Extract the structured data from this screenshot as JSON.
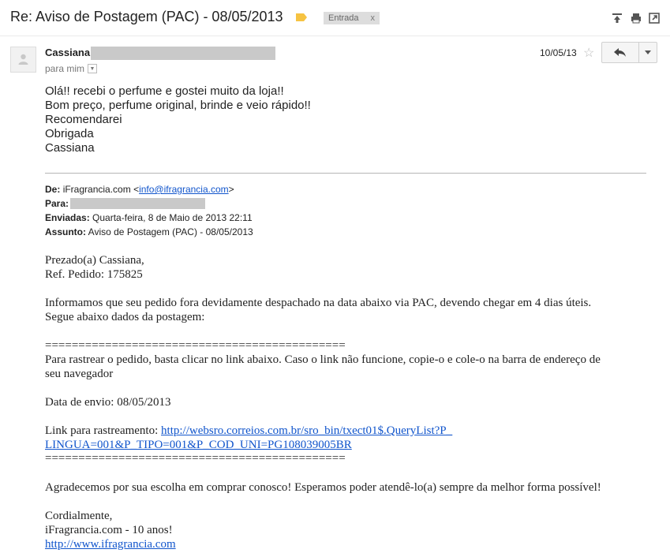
{
  "header": {
    "subject": "Re: Aviso de Postagem (PAC) - 08/05/2013",
    "label_name": "Entrada",
    "label_remove": "x",
    "label_color": "#f6c342",
    "icons": [
      "archive-icon",
      "print-icon",
      "new-window-icon"
    ]
  },
  "message": {
    "sender_name": "Cassiana",
    "to_text": "para mim",
    "date": "10/05/13",
    "body_lines": [
      "Olá!! recebi o perfume e gostei muito da loja!!",
      "Bom preço, perfume original, brinde e veio rápido!!",
      "Recomendarei",
      "Obrigada",
      "Cassiana"
    ]
  },
  "quoted": {
    "from_label": "De:",
    "from_name": "iFragrancia.com",
    "from_open": "<",
    "from_email": "info@ifragrancia.com",
    "from_close": ">",
    "to_label": "Para:",
    "sent_label": "Enviadas:",
    "sent_value": "Quarta-feira, 8 de Maio de 2013 22:11",
    "subject_label": "Assunto:",
    "subject_value": "Aviso de Postagem (PAC) - 08/05/2013",
    "greeting": "Prezado(a) Cassiana,",
    "ref": "Ref. Pedido: 175825",
    "para1_line1": "Informamos que seu pedido fora devidamente despachado na data abaixo via PAC, devendo chegar em 4 dias úteis.",
    "para1_line2": "Segue abaixo dados da postagem:",
    "separator": "=============================================",
    "track_line1": "Para rastrear o pedido, basta clicar no link abaixo. Caso o link não funcione, copie-o e cole-o na barra de endereço de",
    "track_line2": "seu navegador",
    "ship_date": "Data de envio: 08/05/2013",
    "link_label": "Link para rastreamento: ",
    "link_part1": "http://websro.correios.com.br/sro_bin/txect01$.QueryList?P_",
    "link_part2": "LINGUA=001&P_TIPO=001&P_COD_UNI=PG108039005BR",
    "thanks": "Agradecemos por sua escolha em comprar conosco! Esperamos poder atendê-lo(a) sempre da melhor forma possível!",
    "closing": "Cordialmente,",
    "signature": "iFragrancia.com - 10 anos!",
    "website": "http://www.ifragrancia.com"
  }
}
